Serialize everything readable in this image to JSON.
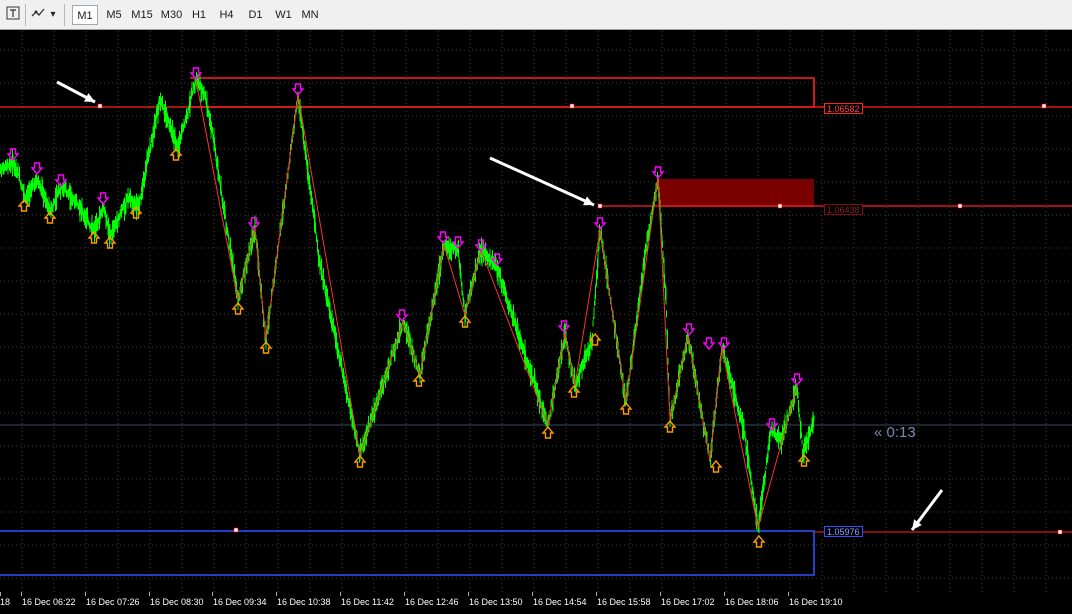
{
  "toolbar": {
    "icons": [
      "cursor-text-icon",
      "draw-tools-icon"
    ],
    "dropdown_arrow": "▾",
    "timeframes": [
      {
        "label": "M1",
        "active": true
      },
      {
        "label": "M5",
        "active": false
      },
      {
        "label": "M15",
        "active": false
      },
      {
        "label": "M30",
        "active": false
      },
      {
        "label": "H1",
        "active": false
      },
      {
        "label": "H4",
        "active": false
      },
      {
        "label": "D1",
        "active": false
      },
      {
        "label": "W1",
        "active": false
      },
      {
        "label": "MN",
        "active": false
      }
    ]
  },
  "chart": {
    "price_labels": {
      "upper_resistance": "1.06582",
      "mid_resistance": "1.06438",
      "support": "1.05976"
    },
    "countdown": "« 0:13",
    "colors": {
      "background": "#000000",
      "grid": "#3a3a3a",
      "price": "#00ff00",
      "resistance": "#ff2020",
      "resistance_fill": "#7a0000",
      "support": "#3050ff",
      "zigzag": "#ff3030",
      "down_arrow": "#ff00ff",
      "up_arrow": "#ff9900",
      "annotation_arrow": "#ffffff"
    },
    "time_labels": [
      "18",
      "16 Dec 06:22",
      "16 Dec 07:26",
      "16 Dec 08:30",
      "16 Dec 09:34",
      "16 Dec 10:38",
      "16 Dec 11:42",
      "16 Dec 12:46",
      "16 Dec 13:50",
      "16 Dec 14:54",
      "16 Dec 15:58",
      "16 Dec 17:02",
      "16 Dec 18:06",
      "16 Dec 19:10"
    ]
  }
}
